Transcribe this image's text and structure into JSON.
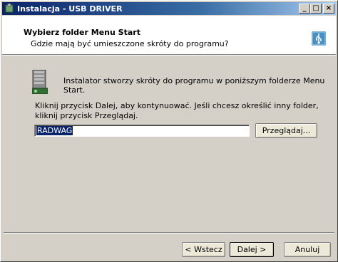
{
  "window": {
    "title": "Instalacja - USB DRIVER",
    "minimize": "_",
    "maximize": "□",
    "close": "×"
  },
  "header": {
    "title": "Wybierz folder Menu Start",
    "subtitle": "Gdzie mają być umieszczone skróty do programu?"
  },
  "body": {
    "intro": "Instalator stworzy skróty do programu w poniższym folderze Menu Start.",
    "instructions": "Kliknij przycisk Dalej, aby kontynuować. Jeśli chcesz określić inny folder, kliknij przycisk Przeglądaj.",
    "folder_value": "RADWAG",
    "browse_label": "Przeglądaj..."
  },
  "footer": {
    "back_label": "< Wstecz",
    "next_label": "Dalej >",
    "cancel_label": "Anuluj"
  },
  "icons": {
    "title": "installer-icon",
    "header": "usb-icon",
    "body": "start-menu-folder-icon"
  },
  "colors": {
    "titlebar": "#0a246a",
    "dialog_bg": "#d4d0c8",
    "selection": "#0a246a"
  }
}
